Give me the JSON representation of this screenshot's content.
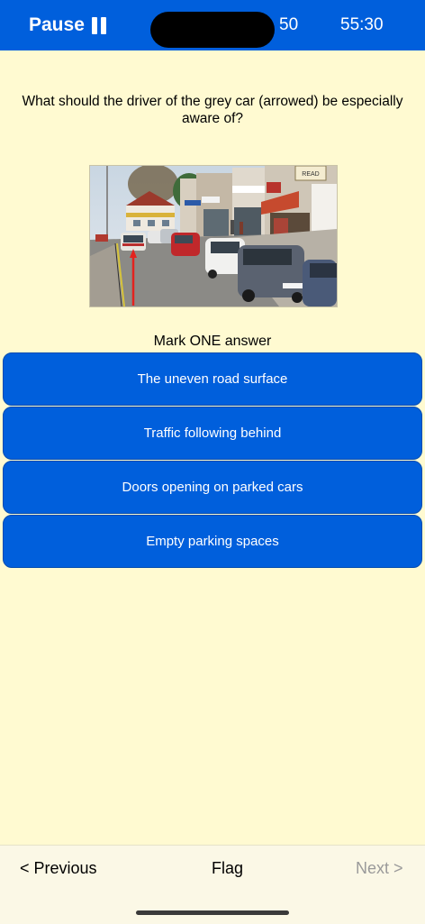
{
  "header": {
    "pause_label": "Pause",
    "question_counter": "50",
    "timer": "55:30"
  },
  "question": {
    "text": "What should the driver of the grey car (arrowed) be especially aware of?"
  },
  "instructions": "Mark ONE answer",
  "answers": [
    {
      "label": "The uneven road surface"
    },
    {
      "label": "Traffic following behind"
    },
    {
      "label": "Doors opening on parked cars"
    },
    {
      "label": "Empty parking spaces"
    }
  ],
  "photo": {
    "shop_sign": "READ"
  },
  "footer": {
    "previous_label": "< Previous",
    "flag_label": "Flag",
    "next_label": "Next >"
  },
  "colors": {
    "accent": "#005FDC",
    "background": "#FFFAD1",
    "disabled_text": "#9A9A9A"
  }
}
